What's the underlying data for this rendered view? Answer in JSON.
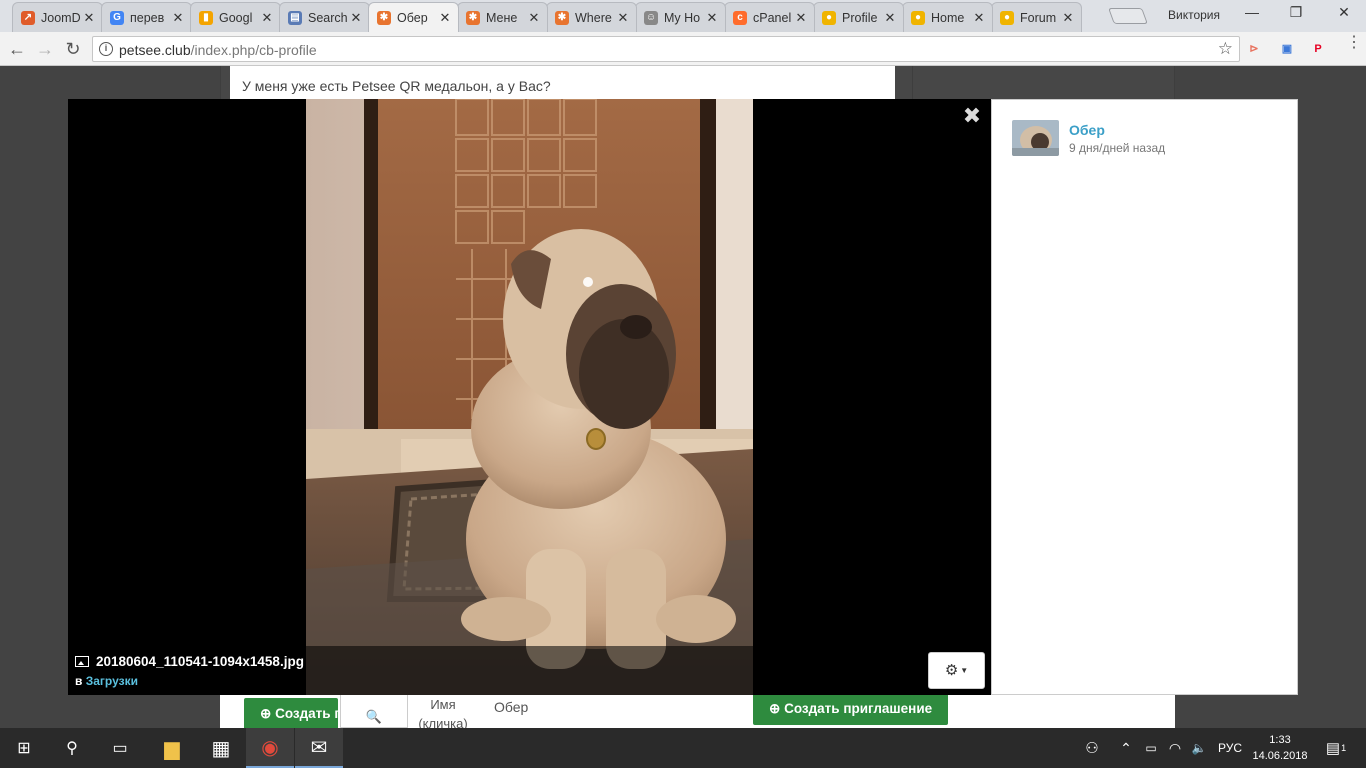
{
  "browser": {
    "tabs": [
      {
        "label": "JoomD",
        "color": "#e05c2a",
        "glyph": "↗"
      },
      {
        "label": "перев",
        "color": "#4285f4",
        "glyph": "G"
      },
      {
        "label": "Googl",
        "color": "#f4a400",
        "glyph": "▮"
      },
      {
        "label": "Search",
        "color": "#5a7bb5",
        "glyph": "▤"
      },
      {
        "label": "Обер",
        "color": "#e8742f",
        "glyph": "✱"
      },
      {
        "label": "Мене",
        "color": "#e8742f",
        "glyph": "✱"
      },
      {
        "label": "Where",
        "color": "#e8742f",
        "glyph": "✱"
      },
      {
        "label": "My Ho",
        "color": "#888888",
        "glyph": "☺"
      },
      {
        "label": "cPanel",
        "color": "#ff6c2c",
        "glyph": "c"
      },
      {
        "label": "Profile",
        "color": "#f0b400",
        "glyph": "●"
      },
      {
        "label": "Home",
        "color": "#f0b400",
        "glyph": "●"
      },
      {
        "label": "Forum",
        "color": "#f0b400",
        "glyph": "●"
      }
    ],
    "close_glyph": "✕",
    "profile_name": "Виктория",
    "window_controls": {
      "minimize": "—",
      "maximize": "❐",
      "close": "✕"
    },
    "nav": {
      "back": "←",
      "forward": "→",
      "reload": "↻"
    },
    "url_domain": "petsee.club",
    "url_path": "/index.php/cb-profile",
    "info_glyph": "i",
    "star_glyph": "☆",
    "extensions": [
      {
        "glyph": "⊳",
        "color": "#e8735f"
      },
      {
        "glyph": "▣",
        "color": "#3c78d8"
      },
      {
        "glyph": "P",
        "color": "#e60023"
      }
    ],
    "menu_glyph": "⋮"
  },
  "page": {
    "status_text": "У меня уже есть Petsee QR медальон, а у Вас?",
    "create_button_1": "Создать п",
    "create_button_2": "Создать приглашение",
    "plus_glyph": "⊕",
    "search_glyph": "🔍",
    "field_label_line1": "Имя",
    "field_label_line2": "(кличка)",
    "field_value": "Обер"
  },
  "lightbox": {
    "close_glyph": "✖",
    "filename": "20180604_110541-1094x1458.jpg",
    "album_prefix": "в",
    "album_name": "Загрузки",
    "gear_glyph": "⚙",
    "caret_glyph": "▼",
    "owner_name": "Обер",
    "owner_time": "9 дня/дней назад"
  },
  "taskbar": {
    "start_glyph": "⊞",
    "search_glyph": "⚲",
    "taskview_glyph": "▭",
    "apps": [
      {
        "name": "file-explorer-icon",
        "glyph": "▆",
        "color": "#f0c24a"
      },
      {
        "name": "store-icon",
        "glyph": "▦",
        "color": "#ffffff"
      },
      {
        "name": "chrome-icon",
        "glyph": "◉",
        "color": "#e04a3c"
      },
      {
        "name": "mail-icon",
        "glyph": "✉",
        "color": "#ffffff"
      }
    ],
    "tray": {
      "people": "⚇",
      "chevron": "⌃",
      "battery": "▭",
      "wifi": "◠",
      "volume": "🔈",
      "language": "РУС",
      "notifications": "▤",
      "notification_count": "1"
    },
    "time": "1:33",
    "date": "14.06.2018"
  }
}
